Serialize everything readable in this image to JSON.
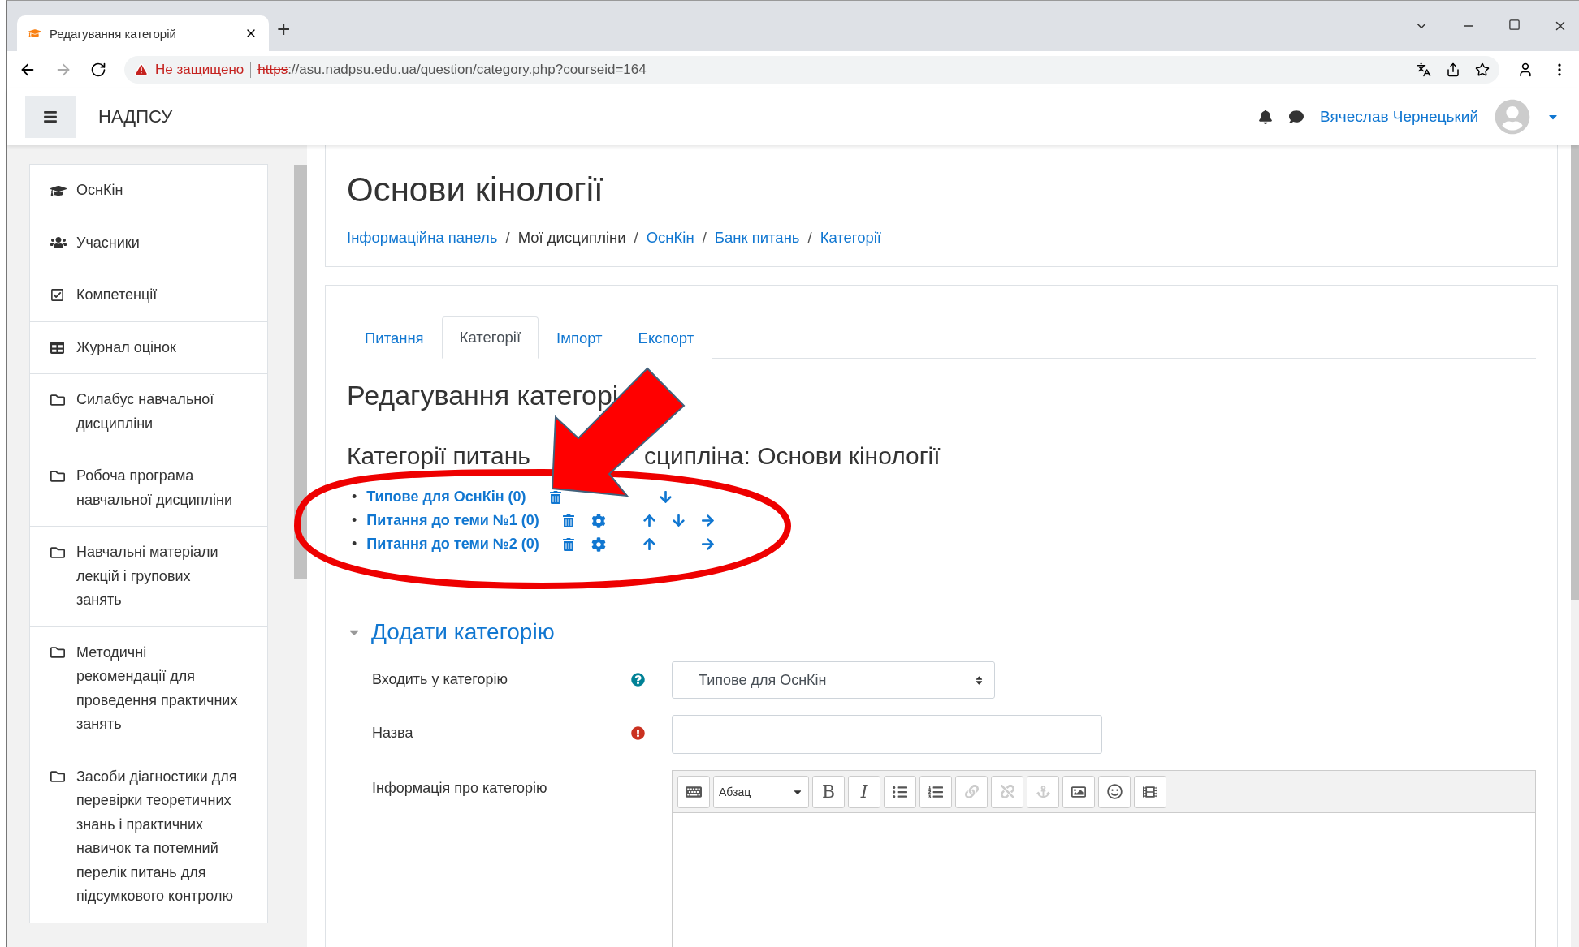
{
  "browser": {
    "tab_title": "Редагування категорій",
    "new_tab": "+",
    "security": "Не защищено",
    "scheme": "https",
    "url_rest": "://asu.nadpsu.edu.ua/question/category.php?courseid=164"
  },
  "navbar": {
    "site_name": "НАДПСУ",
    "user_name": "Вячеслав Чернецький"
  },
  "sidebar": {
    "items": [
      {
        "kind": "course",
        "label": "ОснКін"
      },
      {
        "kind": "users",
        "label": "Учасники"
      },
      {
        "kind": "competency",
        "label": "Компетенції"
      },
      {
        "kind": "grades",
        "label": "Журнал оцінок"
      },
      {
        "kind": "folder",
        "label": "Силабус навчальної дисципліни"
      },
      {
        "kind": "folder",
        "label": "Робоча програма навчальної дисципліни"
      },
      {
        "kind": "folder",
        "label": "Навчальні матеріали лекцій і групових занять"
      },
      {
        "kind": "folder",
        "label": "Методичні рекомендації для проведення практичних занять"
      },
      {
        "kind": "folder",
        "label": "Засоби діагностики для перевірки теоретичних знань і практичних навичок та потемний перелік питань для підсумкового контролю"
      }
    ]
  },
  "header": {
    "title": "Основи кінології",
    "breadcrumb": [
      {
        "label": "Інформаційна панель",
        "link": true
      },
      {
        "label": "Мої дисципліни",
        "link": false
      },
      {
        "label": "ОснКін",
        "link": true
      },
      {
        "label": "Банк питань",
        "link": true
      },
      {
        "label": "Категорії",
        "link": true
      }
    ],
    "separator": "/"
  },
  "tabs": [
    {
      "label": "Питання",
      "selected": false
    },
    {
      "label": "Категорії",
      "selected": true
    },
    {
      "label": "Імпорт",
      "selected": false
    },
    {
      "label": "Експорт",
      "selected": false
    }
  ],
  "page_heading": "Редагування категорі",
  "section_heading": {
    "before_arrow": "Категорії питань",
    "after_arrow": "сципліна: Основи кінології"
  },
  "bullet": "•",
  "categories": [
    {
      "name": "Типове для ОснКін (0)",
      "actions": [
        {
          "kind": "delete"
        },
        {
          "kind": "down"
        }
      ]
    },
    {
      "name": "Питання до теми №1 (0)",
      "actions": [
        {
          "kind": "delete"
        },
        {
          "kind": "edit"
        },
        {
          "kind": "up"
        },
        {
          "kind": "down"
        },
        {
          "kind": "right"
        }
      ]
    },
    {
      "name": "Питання до теми №2 (0)",
      "actions": [
        {
          "kind": "delete"
        },
        {
          "kind": "edit"
        },
        {
          "kind": "up"
        },
        {
          "kind": "right"
        }
      ]
    }
  ],
  "add_category": {
    "title": "Додати категорію",
    "expanded": true,
    "parent": {
      "label": "Входить у категорію",
      "value": "Типове для ОснКін"
    },
    "name": {
      "label": "Назва"
    },
    "info": {
      "label": "Інформація про категорію",
      "format": "Абзац",
      "tools": [
        {
          "kind": "keyboard",
          "disabled": false
        },
        {
          "kind": "format"
        },
        {
          "kind": "bold",
          "text": "B",
          "disabled": false
        },
        {
          "kind": "italic",
          "text": "I",
          "disabled": false
        },
        {
          "kind": "ul",
          "disabled": false
        },
        {
          "kind": "ol",
          "disabled": false
        },
        {
          "kind": "link",
          "disabled": true
        },
        {
          "kind": "unlink",
          "disabled": true
        },
        {
          "kind": "anchor",
          "disabled": true
        },
        {
          "kind": "image",
          "disabled": false
        },
        {
          "kind": "emoji",
          "disabled": false
        },
        {
          "kind": "media",
          "disabled": false
        }
      ]
    }
  }
}
